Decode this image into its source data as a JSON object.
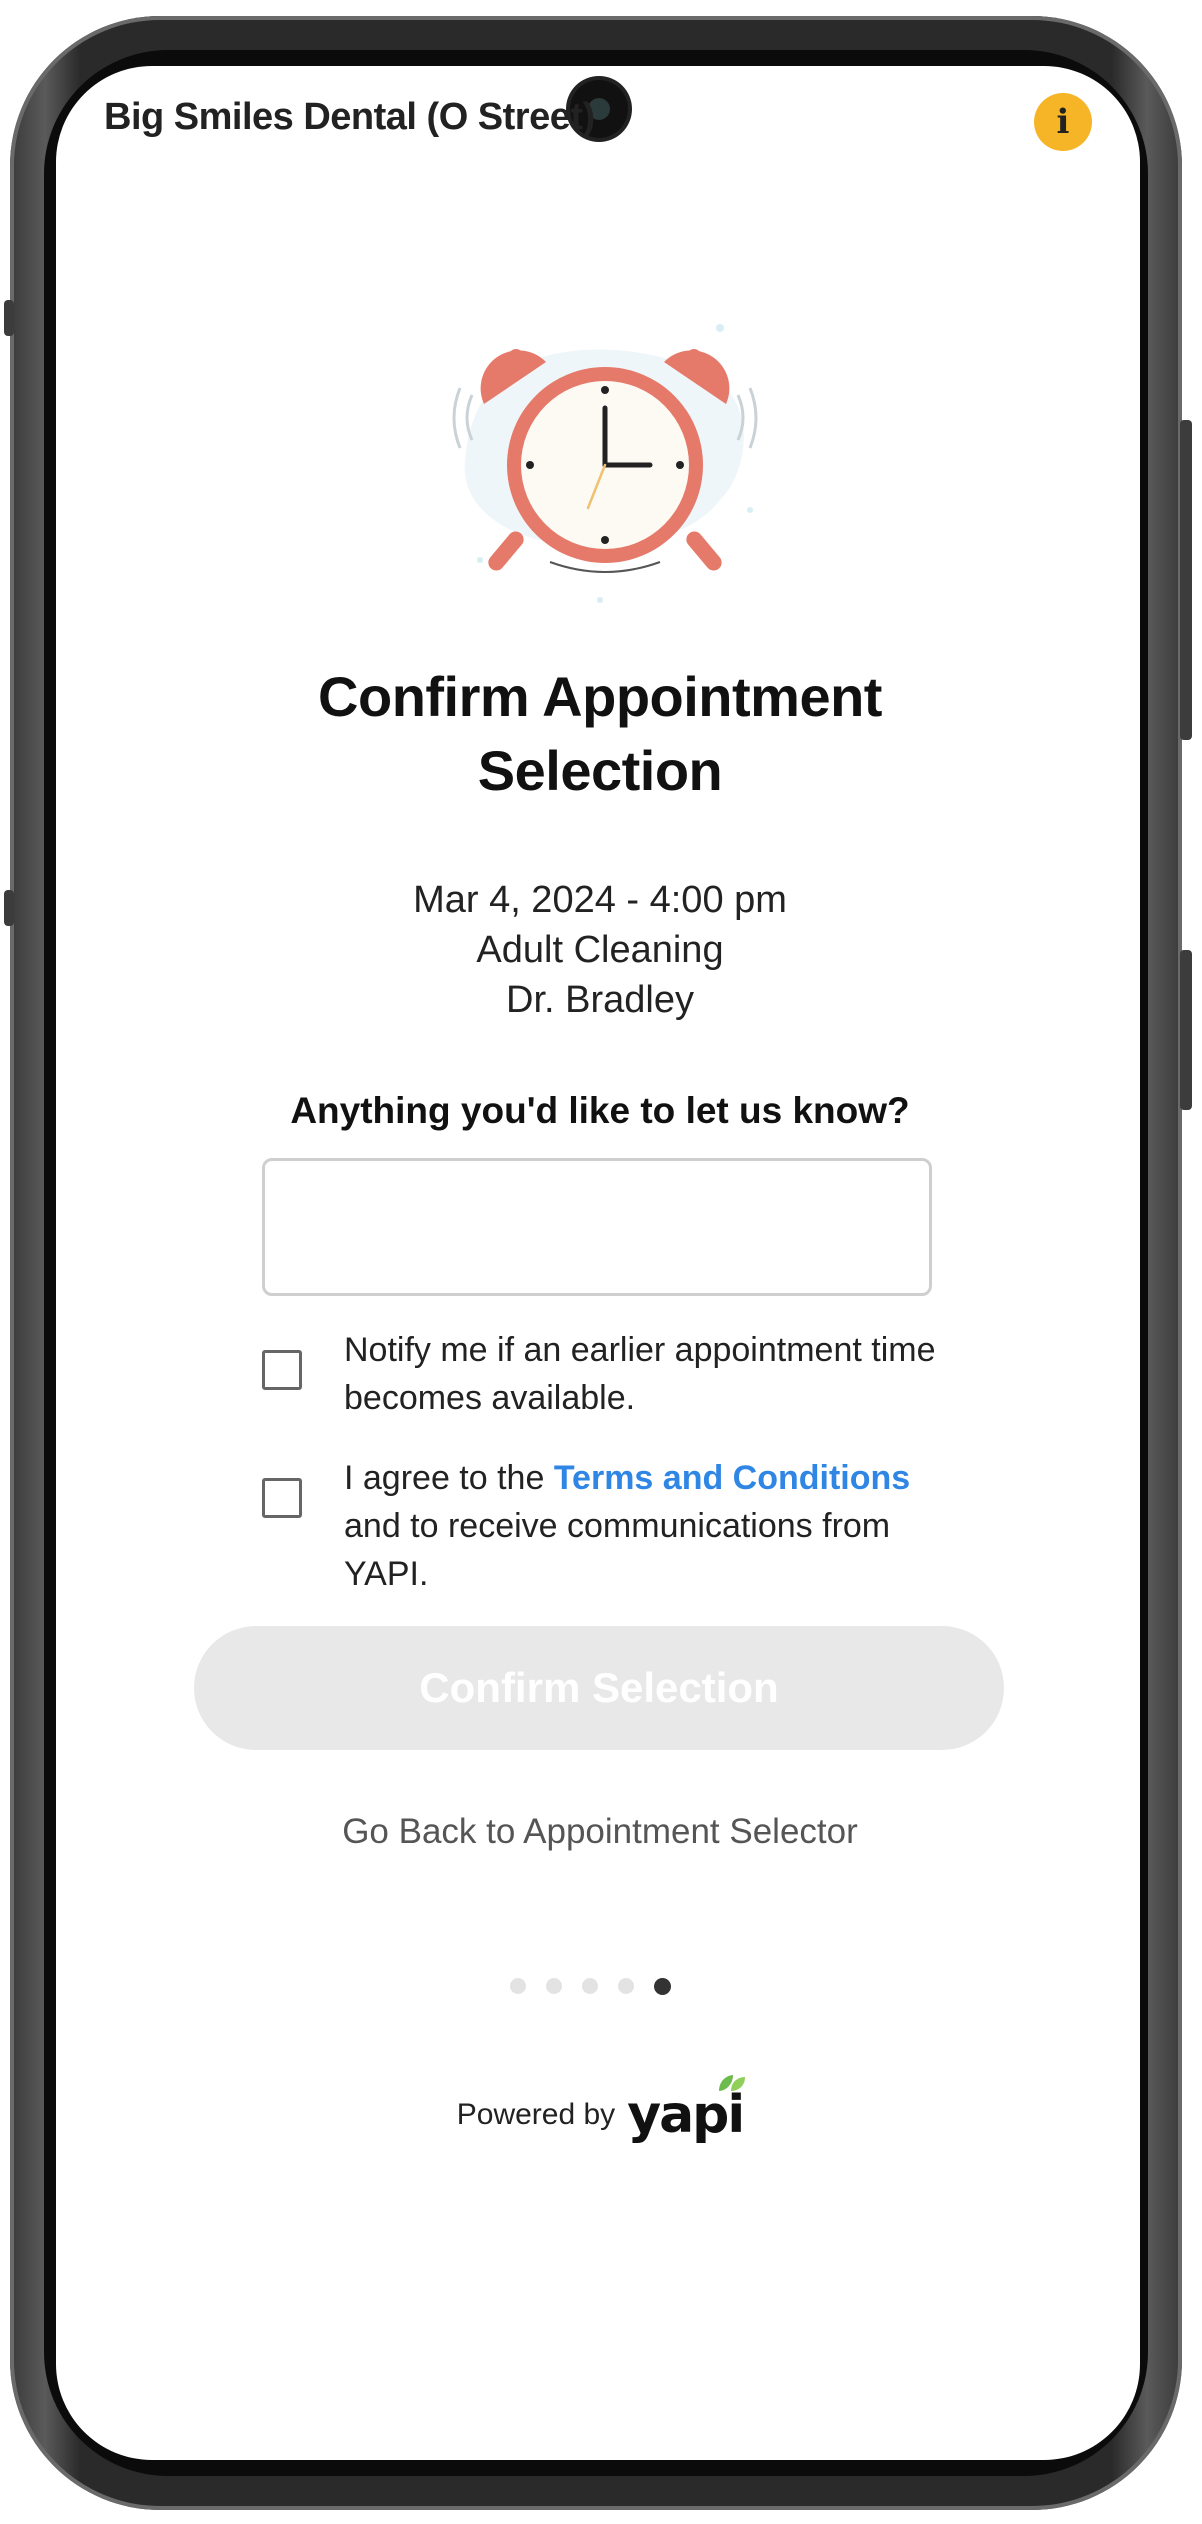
{
  "header": {
    "clinic_name": "Big Smiles Dental (O Street)",
    "info_icon_label": "i"
  },
  "main": {
    "illustration": "alarm-clock-illustration",
    "title_line1": "Confirm Appointment",
    "title_line2": "Selection",
    "appointment": {
      "datetime": "Mar 4, 2024 - 4:00 pm",
      "service": "Adult Cleaning",
      "provider": "Dr. Bradley"
    },
    "notes_question": "Anything you'd like to let us know?",
    "notes_value": "",
    "notify_checkbox": {
      "checked": false,
      "label": "Notify me if an earlier appointment time becomes available."
    },
    "terms_checkbox": {
      "checked": false,
      "label_before": "I agree to the ",
      "link_text": "Terms and Conditions",
      "label_after": " and to receive communications from YAPI."
    },
    "confirm_button": "Confirm Selection",
    "back_link": "Go Back to Appointment Selector",
    "progress": {
      "total_steps": 5,
      "current_step": 5
    }
  },
  "footer": {
    "powered_by": "Powered by",
    "brand": "yapi"
  },
  "colors": {
    "info_badge": "#f5b527",
    "link": "#2f86e4",
    "button_disabled": "#e8e8e8",
    "clock": "#e57a6a"
  }
}
